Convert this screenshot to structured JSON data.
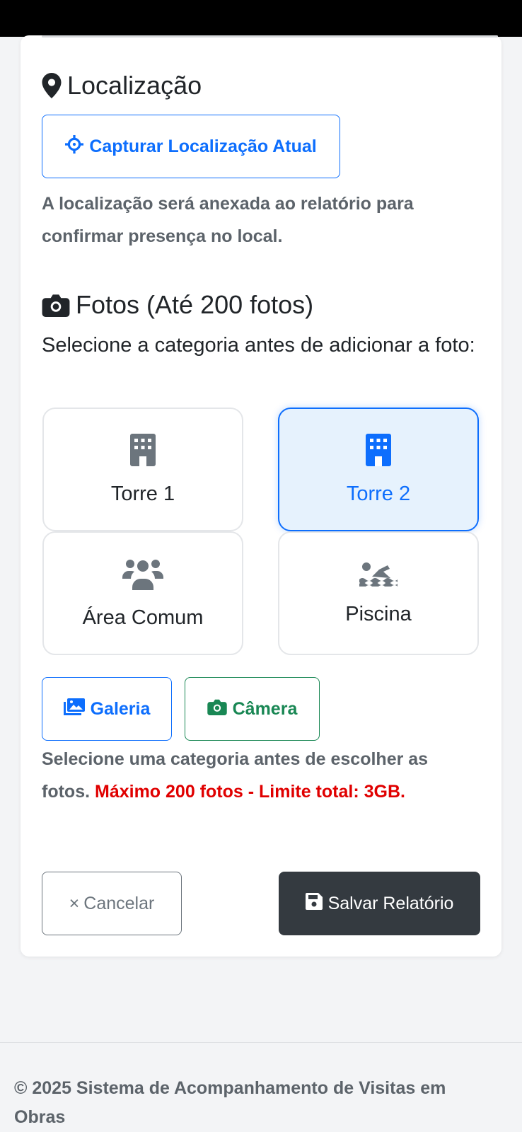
{
  "location": {
    "title": "Localização",
    "capture_button": "Capturar Localização Atual",
    "help_text": "A localização será anexada ao relatório para confirmar presença no local."
  },
  "photos": {
    "title": "Fotos (Até 200 fotos)",
    "instruction": "Selecione a categoria antes de adicionar a foto:",
    "categories": [
      {
        "label": "Torre 1",
        "icon": "building-icon",
        "selected": false
      },
      {
        "label": "Torre 2",
        "icon": "building-icon",
        "selected": true
      },
      {
        "label": "Área Comum",
        "icon": "users-icon",
        "selected": false
      },
      {
        "label": "Piscina",
        "icon": "swimmer-icon",
        "selected": false
      }
    ],
    "gallery_button": "Galeria",
    "camera_button": "Câmera",
    "help_text": "Selecione uma categoria antes de escolher as fotos.",
    "limit_text": "Máximo 200 fotos - Limite total: 3GB."
  },
  "actions": {
    "cancel": "Cancelar",
    "cancel_icon": "×",
    "save": "Salvar Relatório"
  },
  "footer": {
    "copyright": "© 2025 Sistema de Acompanhamento de Visitas em Obras"
  },
  "colors": {
    "primary": "#0d6efd",
    "success": "#198754",
    "danger": "#e00000",
    "dark": "#343a40",
    "muted": "#5c636a",
    "selected_bg": "#e6f2fd"
  }
}
